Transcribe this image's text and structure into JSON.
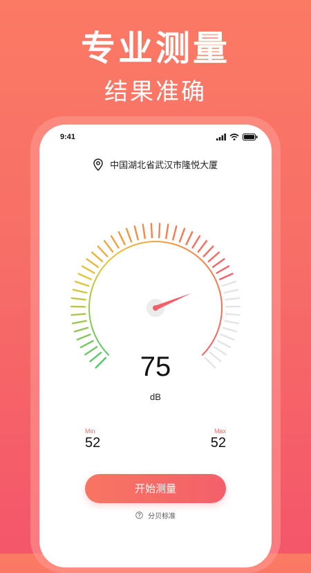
{
  "promo": {
    "title": "专业测量",
    "subtitle": "结果准确"
  },
  "status_bar": {
    "time": "9:41",
    "icons": [
      "signal-icon",
      "wifi-icon",
      "battery-icon"
    ]
  },
  "location": {
    "icon": "location-pin-icon",
    "text": "中国湖北省武汉市隆悦大厦"
  },
  "meter": {
    "value": "75",
    "unit": "dB",
    "level_fraction": 0.75,
    "min_label": "Min",
    "min_value": "52",
    "max_label": "Max",
    "max_value": "52"
  },
  "actions": {
    "start_label": "开始测量",
    "standard_label": "分贝标准",
    "standard_icon": "question-circle-icon"
  },
  "colors": {
    "accent": "#f4606a",
    "gauge_green": "#52c76b",
    "gauge_yellow": "#e8c43a",
    "gauge_orange": "#f5824a",
    "gauge_inactive": "#e4e4e4"
  }
}
